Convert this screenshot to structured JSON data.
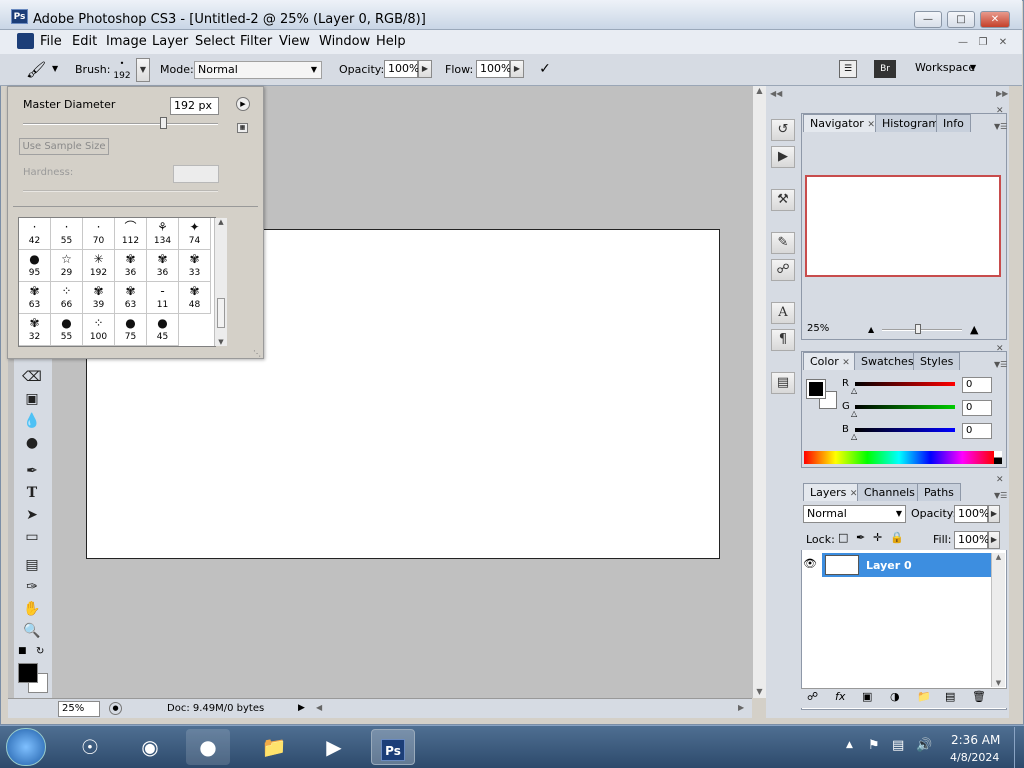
{
  "window": {
    "title": "Adobe Photoshop CS3 - [Untitled-2 @ 25% (Layer 0, RGB/8)]",
    "app_icon": "Ps"
  },
  "menu": [
    "File",
    "Edit",
    "Image",
    "Layer",
    "Select",
    "Filter",
    "View",
    "Window",
    "Help"
  ],
  "options": {
    "brush_label": "Brush:",
    "brush_size": "192",
    "mode_label": "Mode:",
    "mode_value": "Normal",
    "opacity_label": "Opacity:",
    "opacity_value": "100%",
    "flow_label": "Flow:",
    "flow_value": "100%",
    "workspace_label": "Workspace"
  },
  "brush_picker": {
    "master_diameter_label": "Master Diameter",
    "master_diameter_value": "192 px",
    "master_diameter_slider": 0.72,
    "use_sample_size_label": "Use Sample Size",
    "hardness_label": "Hardness:",
    "hardness_value": "",
    "presets": [
      "42",
      "55",
      "70",
      "112",
      "134",
      "74",
      "95",
      "29",
      "192",
      "36",
      "36",
      "33",
      "63",
      "66",
      "39",
      "63",
      "11",
      "48",
      "32",
      "55",
      "100",
      "75",
      "45"
    ]
  },
  "status": {
    "zoom": "25%",
    "doc_info": "Doc: 9.49M/0 bytes"
  },
  "navigator": {
    "tabs": [
      "Navigator",
      "Histogram",
      "Info"
    ],
    "zoom": "25%",
    "zoom_slider": 0.45,
    "view_box_color": "#c84c4c"
  },
  "color": {
    "tabs": [
      "Color",
      "Swatches",
      "Styles"
    ],
    "channels": [
      {
        "label": "R",
        "value": "0"
      },
      {
        "label": "G",
        "value": "0"
      },
      {
        "label": "B",
        "value": "0"
      }
    ]
  },
  "layers": {
    "tabs": [
      "Layers",
      "Channels",
      "Paths"
    ],
    "blend_mode": "Normal",
    "opacity_label": "Opacity:",
    "opacity_value": "100%",
    "lock_label": "Lock:",
    "fill_label": "Fill:",
    "fill_value": "100%",
    "layer_name": "Layer 0"
  },
  "taskbar": {
    "time": "2:36 AM",
    "date": "4/8/2024",
    "active_app": "Ps"
  }
}
